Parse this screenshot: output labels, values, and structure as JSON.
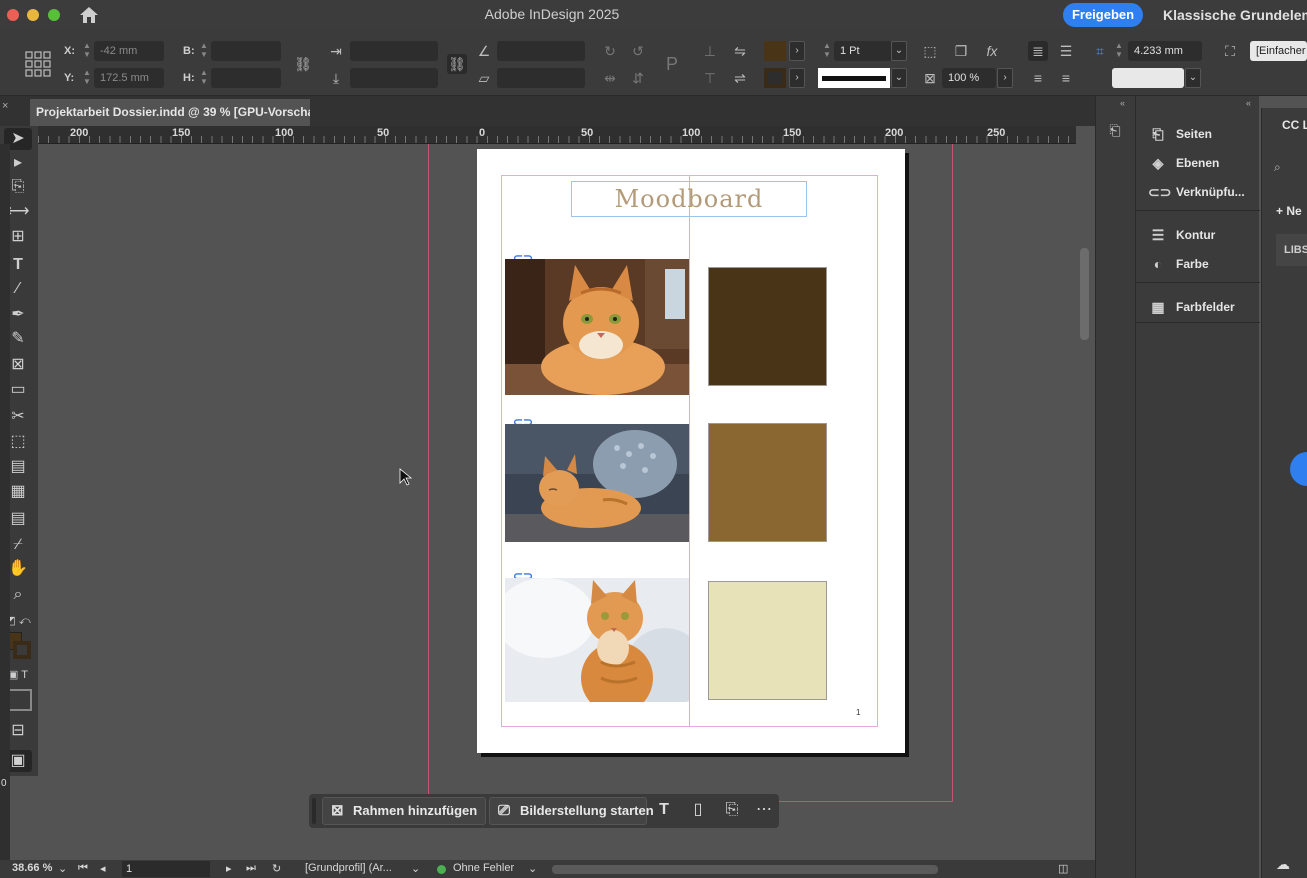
{
  "window": {
    "title": "Adobe InDesign 2025",
    "share_label": "Freigeben",
    "workspace_label": "Klassische Grundelem"
  },
  "control_bar": {
    "x_label": "X:",
    "y_label": "Y:",
    "x_value": "-42 mm",
    "y_value": "172.5 mm",
    "w_label": "B:",
    "h_label": "H:",
    "stroke_weight": "1 Pt",
    "opacity": "100 %",
    "gap_value": "4.233 mm",
    "style_label": "[Einfacher",
    "fill_color": "#4a3418",
    "stroke_color": "#3a2a18"
  },
  "document": {
    "tab_title": "Projektarbeit Dossier.indd @ 39 % [GPU-Vorschau]",
    "close_icon": "×"
  },
  "ruler": {
    "labels": [
      "200",
      "150",
      "100",
      "50",
      "0",
      "50",
      "100",
      "150",
      "200",
      "250"
    ]
  },
  "page": {
    "heading": "Moodboard",
    "page_number": "1",
    "swatches": [
      {
        "color": "#4a3418"
      },
      {
        "color": "#8a6631"
      },
      {
        "color": "#e8e2b8"
      }
    ],
    "photos": [
      {
        "subject": "orange tabby cat lying"
      },
      {
        "subject": "orange tabby cat sleeping on sofa"
      },
      {
        "subject": "orange tabby cat sitting"
      }
    ]
  },
  "taskbar": {
    "add_frame_label": "Rahmen hinzufügen",
    "image_gen_label": "Bilderstellung starten"
  },
  "status_bar": {
    "zoom": "38.66 %",
    "page_field": "1",
    "profile": "[Grundprofil] (Ar...",
    "preflight": "Ohne Fehler",
    "vruler_zero": "0"
  },
  "panels": {
    "items": [
      {
        "label": "Seiten",
        "icon": "pages-icon"
      },
      {
        "label": "Ebenen",
        "icon": "layers-icon"
      },
      {
        "label": "Verknüpfu...",
        "icon": "links-icon"
      },
      {
        "label": "Kontur",
        "icon": "stroke-icon"
      },
      {
        "label": "Farbe",
        "icon": "color-icon"
      },
      {
        "label": "Farbfelder",
        "icon": "swatches-icon"
      }
    ],
    "cc_title": "CC L",
    "cc_new": "+ Ne",
    "cc_lib": "LIBS"
  }
}
